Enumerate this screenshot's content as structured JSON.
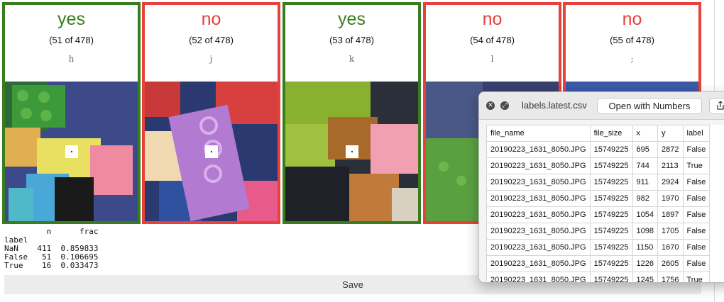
{
  "cards": [
    {
      "verdict": "yes",
      "counter": "(51 of 478)",
      "key": "h"
    },
    {
      "verdict": "no",
      "counter": "(52 of 478)",
      "key": "j"
    },
    {
      "verdict": "yes",
      "counter": "(53 of 478)",
      "key": "k"
    },
    {
      "verdict": "no",
      "counter": "(54 of 478)",
      "key": "l"
    },
    {
      "verdict": "no",
      "counter": "(55 of 478)",
      "key": ";"
    }
  ],
  "stats_text": "         n      frac\nlabel\nNaN    411  0.859833\nFalse   51  0.106695\nTrue    16  0.033473",
  "save_label": "Save",
  "preview": {
    "title": "labels.latest.csv",
    "open_button": "Open with Numbers",
    "headers": [
      "file_name",
      "file_size",
      "x",
      "y",
      "label"
    ],
    "rows": [
      [
        "20190223_1631_8050.JPG",
        "15749225",
        "695",
        "2872",
        "False"
      ],
      [
        "20190223_1631_8050.JPG",
        "15749225",
        "744",
        "2113",
        "True"
      ],
      [
        "20190223_1631_8050.JPG",
        "15749225",
        "911",
        "2924",
        "False"
      ],
      [
        "20190223_1631_8050.JPG",
        "15749225",
        "982",
        "1970",
        "False"
      ],
      [
        "20190223_1631_8050.JPG",
        "15749225",
        "1054",
        "1897",
        "False"
      ],
      [
        "20190223_1631_8050.JPG",
        "15749225",
        "1098",
        "1705",
        "False"
      ],
      [
        "20190223_1631_8050.JPG",
        "15749225",
        "1150",
        "1670",
        "False"
      ],
      [
        "20190223_1631_8050.JPG",
        "15749225",
        "1226",
        "2605",
        "False"
      ],
      [
        "20190223_1631_8050.JPG",
        "15749225",
        "1245",
        "1756",
        "True"
      ]
    ]
  },
  "colors": {
    "yes": "#3a7d1e",
    "no": "#e8403a"
  }
}
